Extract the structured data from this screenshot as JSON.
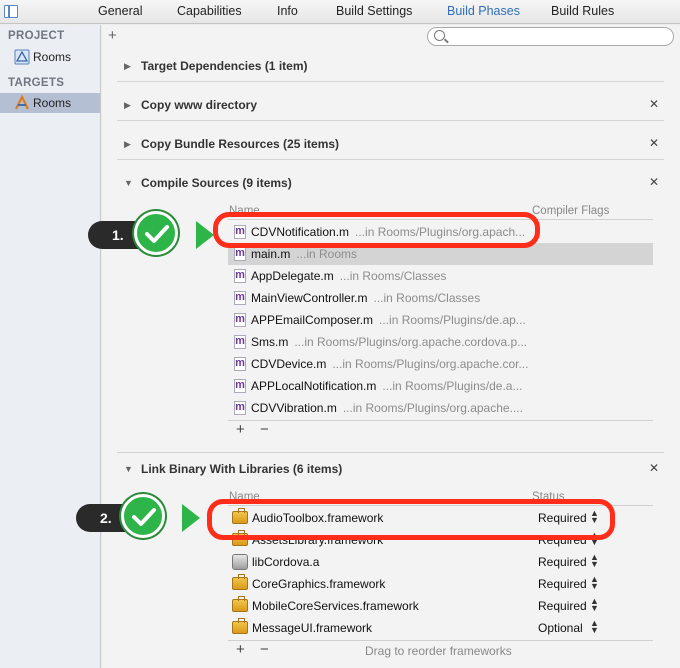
{
  "tabs": [
    {
      "label": "General"
    },
    {
      "label": "Capabilities"
    },
    {
      "label": "Info"
    },
    {
      "label": "Build Settings"
    },
    {
      "label": "Build Phases",
      "active": true
    },
    {
      "label": "Build Rules"
    }
  ],
  "sidebar": {
    "project_header": "PROJECT",
    "project_item": "Rooms",
    "targets_header": "TARGETS",
    "target_item": "Rooms"
  },
  "toolbar": {
    "plus": "+",
    "search_placeholder": ""
  },
  "phases": [
    {
      "title": "Target Dependencies (1 item)",
      "expanded": false,
      "closable": false
    },
    {
      "title": "Copy www directory",
      "expanded": false,
      "closable": true
    },
    {
      "title": "Copy Bundle Resources (25 items)",
      "expanded": false,
      "closable": true
    },
    {
      "title": "Compile Sources (9 items)",
      "expanded": true,
      "closable": true
    },
    {
      "title": "Link Binary With Libraries (6 items)",
      "expanded": true,
      "closable": true
    }
  ],
  "compile_sources": {
    "col_name": "Name",
    "col_flags": "Compiler Flags",
    "files": [
      {
        "name": "CDVNotification.m",
        "path": "...in Rooms/Plugins/org.apach..."
      },
      {
        "name": "main.m",
        "path": "...in Rooms",
        "highlighted": true
      },
      {
        "name": "AppDelegate.m",
        "path": "...in Rooms/Classes"
      },
      {
        "name": "MainViewController.m",
        "path": "...in Rooms/Classes"
      },
      {
        "name": "APPEmailComposer.m",
        "path": "...in Rooms/Plugins/de.ap..."
      },
      {
        "name": "Sms.m",
        "path": "...in Rooms/Plugins/org.apache.cordova.p..."
      },
      {
        "name": "CDVDevice.m",
        "path": "...in Rooms/Plugins/org.apache.cor..."
      },
      {
        "name": "APPLocalNotification.m",
        "path": "...in Rooms/Plugins/de.a..."
      },
      {
        "name": "CDVVibration.m",
        "path": "...in Rooms/Plugins/org.apache...."
      }
    ],
    "add": "+",
    "remove": "−"
  },
  "link_libraries": {
    "col_name": "Name",
    "col_status": "Status",
    "libs": [
      {
        "name": "AudioToolbox.framework",
        "status": "Required",
        "icon": "framework-icon"
      },
      {
        "name": "AssetsLibrary.framework",
        "status": "Required",
        "icon": "framework-icon"
      },
      {
        "name": "libCordova.a",
        "status": "Required",
        "icon": "library-icon"
      },
      {
        "name": "CoreGraphics.framework",
        "status": "Required",
        "icon": "framework-icon"
      },
      {
        "name": "MobileCoreServices.framework",
        "status": "Required",
        "icon": "framework-icon"
      },
      {
        "name": "MessageUI.framework",
        "status": "Optional",
        "icon": "framework-icon"
      }
    ],
    "add": "+",
    "remove": "−",
    "hint": "Drag to reorder frameworks"
  },
  "callouts": [
    {
      "label": "1."
    },
    {
      "label": "2."
    }
  ],
  "colors": {
    "accent": "#2f6fb8",
    "callout_red": "#ff2d1a",
    "check_green": "#2db54a",
    "selected_row": "#b4bfd3"
  }
}
